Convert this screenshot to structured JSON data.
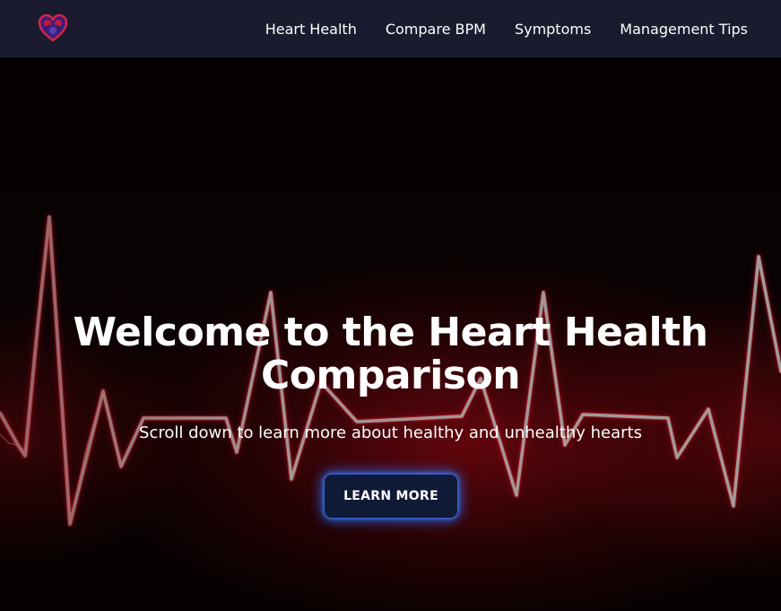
{
  "brand": {
    "logo_icon": "heart-logo-icon",
    "accent_color": "#d6244a"
  },
  "nav": {
    "items": [
      {
        "label": "Heart Health"
      },
      {
        "label": "Compare BPM"
      },
      {
        "label": "Symptoms"
      },
      {
        "label": "Management Tips"
      }
    ]
  },
  "hero": {
    "title_line1": "Welcome to the Heart Health",
    "title_line2": "Comparison",
    "subtitle": "Scroll down to learn more about healthy and unhealthy hearts",
    "cta_label": "LEARN MORE",
    "cta_glow_color": "#2a6bff",
    "background_icon": "ecg-heartbeat-line"
  }
}
